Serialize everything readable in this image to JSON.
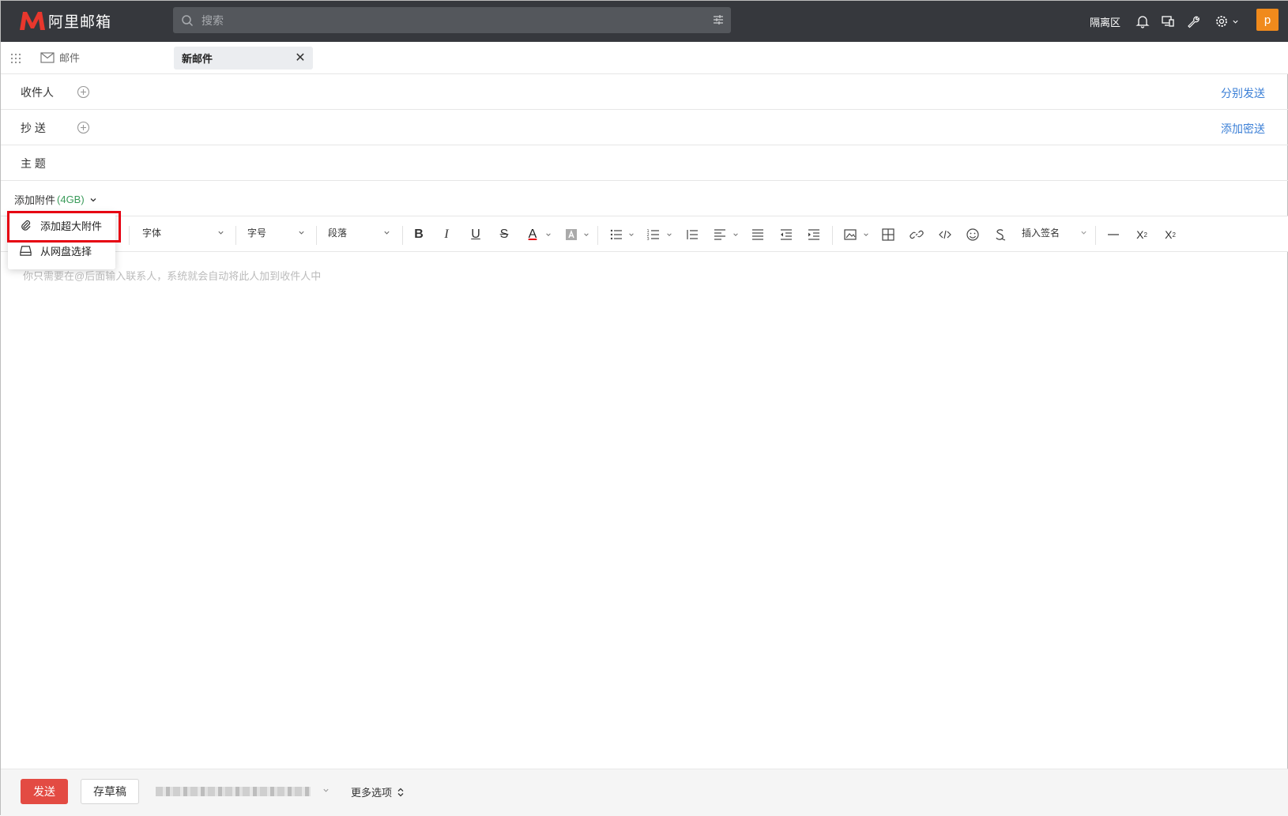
{
  "header": {
    "logo_text": "阿里邮箱",
    "search_placeholder": "搜索",
    "quarantine": "隔离区",
    "avatar_letter": "p",
    "avatar_color": "#f08a1c"
  },
  "tabs": {
    "mail_label": "邮件",
    "new_mail_label": "新邮件"
  },
  "compose": {
    "to_label": "收件人",
    "to_action": "分别发送",
    "cc_label": "抄 送",
    "cc_action": "添加密送",
    "subject_label": "主 题",
    "attach_label": "添加附件",
    "attach_size": "(4GB)"
  },
  "attach_menu": {
    "items": [
      {
        "label": "添加超大附件",
        "icon": "paperclip-icon"
      },
      {
        "label": "从网盘选择",
        "icon": "drive-icon"
      }
    ]
  },
  "toolbar": {
    "font_label": "字体",
    "size_label": "字号",
    "paragraph_label": "段落",
    "bold": "B",
    "italic": "I",
    "underline": "U",
    "strike": "S",
    "font_color": "A",
    "signature_label": "插入签名"
  },
  "editor": {
    "placeholder": "你只需要在@后面输入联系人，系统就会自动将此人加到收件人中"
  },
  "footer": {
    "send_label": "发送",
    "draft_label": "存草稿",
    "more_label": "更多选项"
  },
  "colors": {
    "accent_link": "#3b7fd6",
    "send_button": "#e34b43",
    "highlight_box": "#e60012",
    "topbar": "#36383d"
  }
}
